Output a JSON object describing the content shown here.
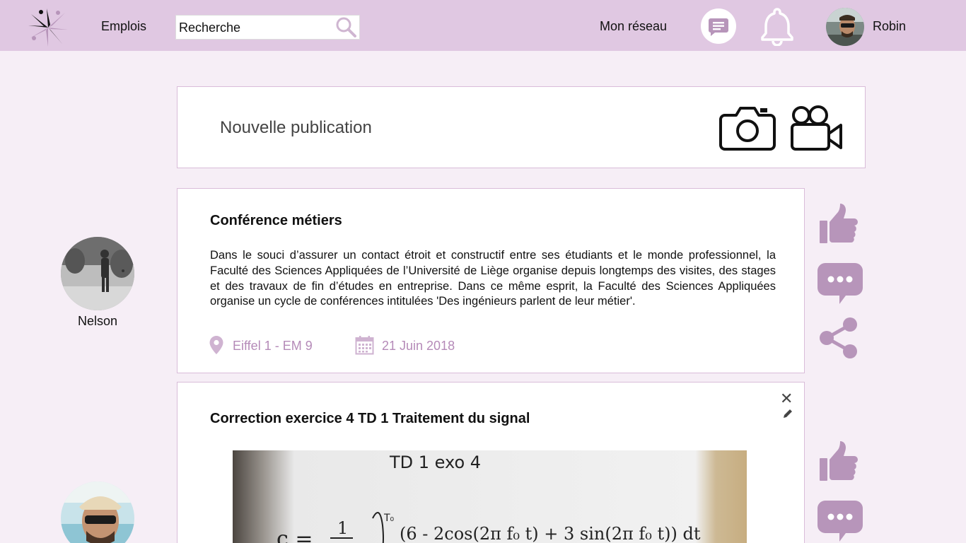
{
  "header": {
    "jobs_label": "Emplois",
    "search_placeholder": "Recherche",
    "network_label": "Mon réseau",
    "user_name": "Robin"
  },
  "new_post": {
    "label": "Nouvelle publication"
  },
  "posts": [
    {
      "author": "Nelson",
      "title": "Conférence métiers",
      "body": "Dans le souci d’assurer un contact étroit et constructif entre ses étudiants et le monde professionnel, la Faculté des Sciences Appliquées de l’Université de Liège organise depuis longtemps des visites, des stages et des travaux de fin d’études en entreprise. Dans ce même esprit, la Faculté des Sciences Appliquées organise un cycle de conférences intitulées 'Des ingénieurs parlent de leur métier'.",
      "location": "Eiffel 1 - EM 9",
      "date": "21 Juin 2018"
    },
    {
      "title": "Correction exercice 4 TD 1 Traitement du signal",
      "image_text": {
        "heading": "TD 1  exo 4",
        "formula": "(6 - 2cos(2π f₀ t) + 3 sin(2π f₀ t)) dt"
      }
    }
  ],
  "colors": {
    "header_bg": "#e0c8e2",
    "page_bg": "#f6eef6",
    "accent": "#b58ab8",
    "icon_purple": "#b795ba"
  },
  "icons": [
    "logo",
    "search-icon",
    "message-icon",
    "bell-icon",
    "camera-icon",
    "video-camera-icon",
    "location-pin-icon",
    "calendar-icon",
    "thumbs-up-icon",
    "comment-icon",
    "share-icon",
    "close-icon",
    "pencil-icon"
  ]
}
